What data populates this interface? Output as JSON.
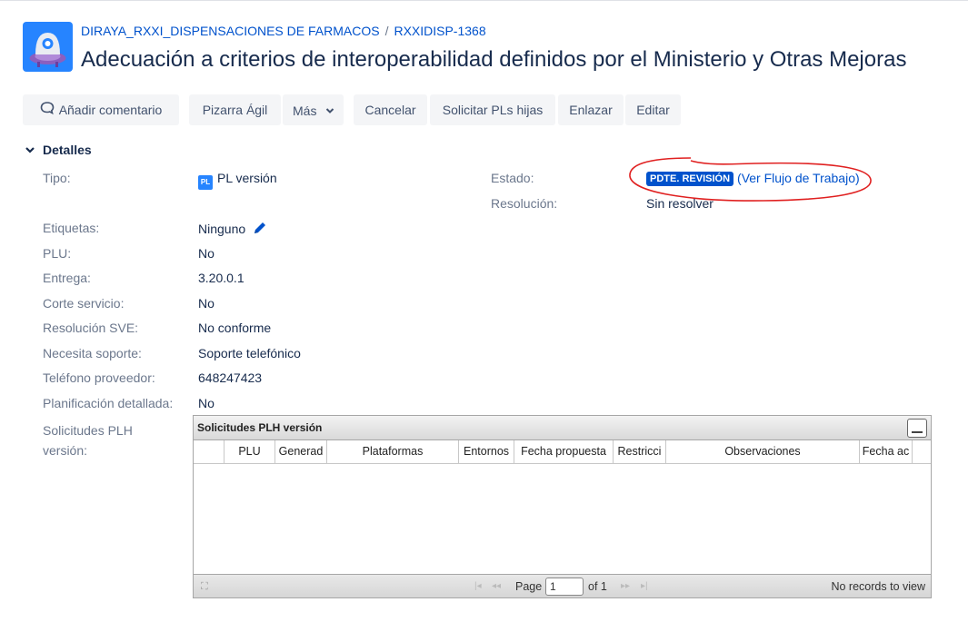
{
  "header": {
    "project_link": "DIRAYA_RXXI_DISPENSACIONES DE FARMACOS",
    "separator": "/",
    "issue_key": "RXXIDISP-1368",
    "title": "Adecuación a criterios de interoperabilidad definidos por el Ministerio y Otras Mejoras"
  },
  "toolbar": {
    "comment": "Añadir comentario",
    "agile": "Pizarra Ágil",
    "more": "Más",
    "cancel": "Cancelar",
    "request_children": "Solicitar PLs hijas",
    "link": "Enlazar",
    "edit": "Editar"
  },
  "details": {
    "heading": "Detalles",
    "type_label": "Tipo:",
    "type_icon_text": "PL",
    "type_value": "PL versión",
    "status_label": "Estado:",
    "status_value": "PDTE. REVISIÓN",
    "workflow_link": "(Ver Flujo de Trabajo)",
    "resolution_label": "Resolución:",
    "resolution_value": "Sin resolver",
    "fields": [
      {
        "label": "Etiquetas:",
        "value": "Ninguno"
      },
      {
        "label": "PLU:",
        "value": "No"
      },
      {
        "label": "Entrega:",
        "value": "3.20.0.1"
      },
      {
        "label": "Corte servicio:",
        "value": "No"
      },
      {
        "label": "Resolución SVE:",
        "value": "No conforme"
      },
      {
        "label": "Necesita soporte:",
        "value": "Soporte telefónico"
      },
      {
        "label": "Teléfono proveedor:",
        "value": "648247423"
      },
      {
        "label": "Planificación detallada:",
        "value": "No"
      }
    ],
    "plh_label_line1": "Solicitudes PLH",
    "plh_label_line2": "versión:"
  },
  "grid": {
    "caption": "Solicitudes PLH versión",
    "columns": [
      "",
      "PLU",
      "Generad",
      "Plataformas",
      "Entornos",
      "Fecha propuesta",
      "Restricci",
      "Observaciones",
      "Fecha ac",
      ""
    ],
    "pager": {
      "page_label": "Page",
      "page_value": "1",
      "of_label": "of 1",
      "records": "No records to view"
    }
  },
  "colors": {
    "link": "#0052cc",
    "status_bg": "#0052cc",
    "annotation": "#e02020",
    "button_bg": "#f4f5f7"
  },
  "icons": [
    "project-avatar-icon",
    "comment-icon",
    "chevron-down-icon",
    "pencil-icon",
    "pl-type-icon",
    "expand-icon",
    "first-page-icon",
    "prev-page-icon",
    "next-page-icon",
    "last-page-icon",
    "minimize-icon"
  ]
}
